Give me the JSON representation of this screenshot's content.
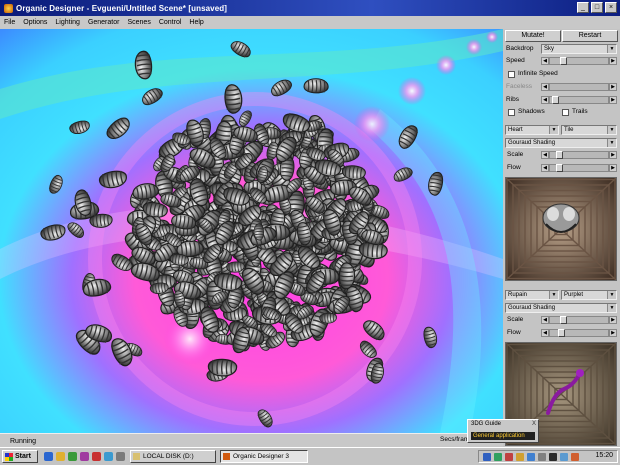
{
  "window": {
    "title": "Organic Designer - Evgueni/Untitled Scene* [unsaved]"
  },
  "menu": [
    "File",
    "Options",
    "Lighting",
    "Generator",
    "Scenes",
    "Control",
    "Help"
  ],
  "panel": {
    "mutate_label": "Mutate!",
    "restart_label": "Restart",
    "backdrop_label": "Backdrop",
    "backdrop_value": "Sky",
    "speed_label": "Speed",
    "infinite_speed_label": "Infinite Speed",
    "faceless_label": "Faceless",
    "ribs_label": "Ribs",
    "shadows_label": "Shadows",
    "trails_label": "Trails",
    "layer1": {
      "shape": "Heart",
      "mode": "Tile",
      "shading": "Gouraud Shading",
      "scale_label": "Scale",
      "flow_label": "Flow"
    },
    "layer2": {
      "shape": "Rupain",
      "mode": "Purplet",
      "shading": "Gouraud Shading",
      "scale_label": "Scale",
      "flow_label": "Flow"
    }
  },
  "status": {
    "text": "Running",
    "right": "Secs/frame"
  },
  "popup": {
    "title": "3DG Guide",
    "close": "X",
    "message": "General application"
  },
  "taskbar": {
    "start_label": "Start",
    "tasks": [
      {
        "label": "LOCAL DISK (D:)",
        "active": false
      },
      {
        "label": "Organic Designer 3",
        "active": true
      }
    ],
    "clock": "15:20"
  },
  "colors": {
    "title_bar": "#1a2e9a",
    "panel": "#c4c4c4",
    "viewport_magenta": "#ff38e0",
    "viewport_cyan": "#36e8ff",
    "viewport_blue": "#3b5cff",
    "highlight": "#ffcc33"
  },
  "icons": [
    "app-icon",
    "minimize-icon",
    "maximize-icon",
    "close-icon",
    "windows-logo-icon",
    "folder-icon",
    "app-task-icon",
    "tray-icon"
  ]
}
